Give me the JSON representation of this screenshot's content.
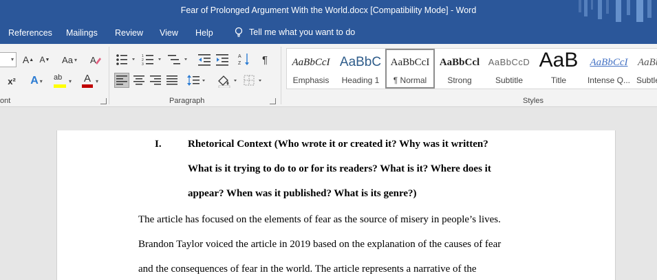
{
  "window": {
    "title": "Fear of Prolonged Argument With the World.docx [Compatibility Mode]  -  Word"
  },
  "menu": {
    "tabs": [
      "References",
      "Mailings",
      "Review",
      "View",
      "Help"
    ],
    "tell_me": "Tell me what you want to do"
  },
  "ribbon": {
    "groups": {
      "font_partial": "ont",
      "paragraph": "Paragraph",
      "styles": "Styles"
    },
    "font": {
      "grow": "A",
      "shrink": "A",
      "change_case": "Aa",
      "superscript": "x²",
      "highlight": "ab",
      "font_color": "A"
    },
    "styles": [
      {
        "sample": "AaBbCcI",
        "name": "Emphasis"
      },
      {
        "sample": "AaBbC",
        "name": "Heading 1"
      },
      {
        "sample": "AaBbCcI",
        "name": "¶ Normal",
        "selected": true
      },
      {
        "sample": "AaBbCcl",
        "name": "Strong"
      },
      {
        "sample": "AaBbCcD",
        "name": "Subtitle"
      },
      {
        "sample": "AaB",
        "name": "Title"
      },
      {
        "sample": "AaBbCcI",
        "name": "Intense Q..."
      },
      {
        "sample": "AaBb",
        "name": "Subtle"
      }
    ],
    "colors": {
      "highlight": "#ffff00",
      "font_color": "#c00000",
      "accent": "#2b579a"
    }
  },
  "document": {
    "heading_number": "I.",
    "heading_lines": [
      "Rhetorical Context (Who wrote it or created it? Why was it written?",
      "What is it trying to do to or for its readers? What is it? Where does it",
      "appear? When was it published? What is its genre?)"
    ],
    "body_lines": [
      "The article has focused on the elements of fear as the source of misery in people’s lives.",
      "Brandon Taylor voiced the article in 2019 based on the explanation of the causes of fear",
      "and the consequences of fear in the world. The article represents a narrative of the"
    ]
  }
}
